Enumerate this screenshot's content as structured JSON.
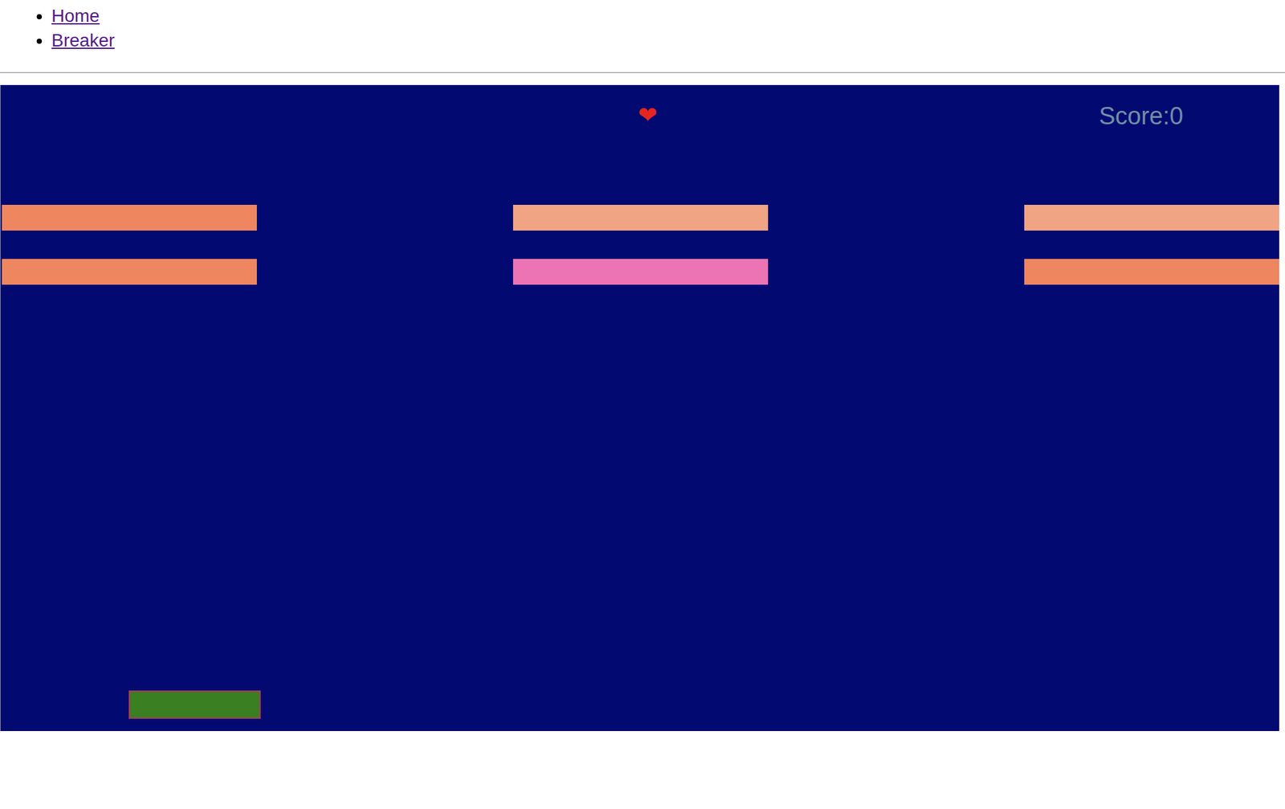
{
  "nav": {
    "links": [
      {
        "label": "Home"
      },
      {
        "label": "Breaker"
      }
    ]
  },
  "game": {
    "lives": [
      "❤"
    ],
    "score": "Score:0",
    "bricks": [
      [
        {
          "color": "#ee8660"
        },
        {
          "color": "#f0a484"
        },
        {
          "color": "#f0a484"
        }
      ],
      [
        {
          "color": "#ee8660"
        },
        {
          "color": "#ec74b4"
        },
        {
          "color": "#ee8660"
        }
      ]
    ],
    "paddle": {
      "color": "#3a7f22"
    }
  }
}
